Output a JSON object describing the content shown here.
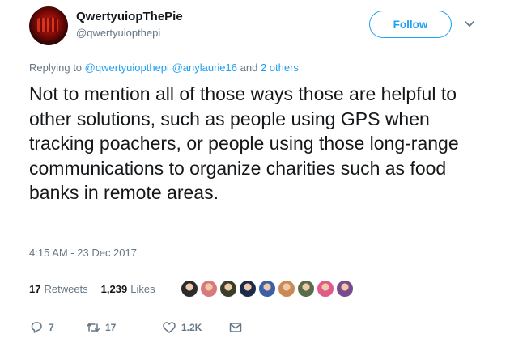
{
  "user": {
    "name": "QwertyuiopThePie",
    "handle": "@qwertyuiopthepi"
  },
  "follow_label": "Follow",
  "reply": {
    "prefix": "Replying to",
    "mention1": "@qwertyuiopthepi",
    "mention2": "@anylaurie16",
    "connector": "and",
    "others": "2 others"
  },
  "tweet": {
    "text": "Not to mention all of those ways those are helpful to other solutions, such as people using GPS when tracking poachers, or people using those long-range communications to organize charities such as food banks in remote areas.",
    "timestamp": "4:15 AM - 23 Dec 2017"
  },
  "stats": {
    "retweets_count": "17",
    "retweets_label": "Retweets",
    "likes_count": "1,239",
    "likes_label": "Likes"
  },
  "likers": [
    {
      "icon": "liker-avatar",
      "color": "#2b2b2b"
    },
    {
      "icon": "liker-avatar",
      "color": "#d97a7a"
    },
    {
      "icon": "liker-avatar",
      "color": "#3a3f2c"
    },
    {
      "icon": "liker-avatar",
      "color": "#1c2b4a"
    },
    {
      "icon": "liker-avatar",
      "color": "#3c5fa8"
    },
    {
      "icon": "liker-avatar",
      "color": "#c98a55"
    },
    {
      "icon": "liker-avatar",
      "color": "#5a6b4a"
    },
    {
      "icon": "liker-avatar",
      "color": "#e05a8a"
    },
    {
      "icon": "liker-avatar",
      "color": "#7a4b8c"
    }
  ],
  "actions": {
    "reply_count": "7",
    "retweet_count": "17",
    "like_count": "1.2K"
  },
  "colors": {
    "accent": "#1da1f2",
    "muted": "#657786",
    "text": "#14171a"
  }
}
